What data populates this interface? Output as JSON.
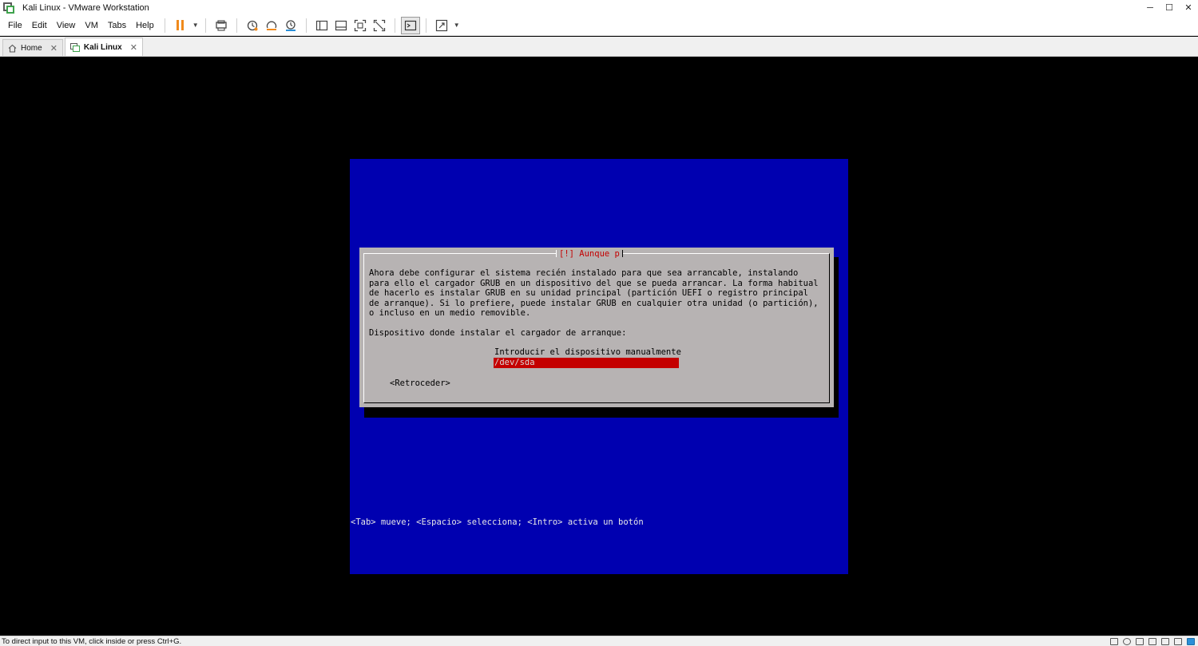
{
  "window": {
    "title": "Kali Linux - VMware Workstation",
    "controls": {
      "minimize": "─",
      "maximize": "☐",
      "close": "✕"
    }
  },
  "menu": [
    "File",
    "Edit",
    "View",
    "VM",
    "Tabs",
    "Help"
  ],
  "toolbar": {
    "icons": [
      "pause-icon",
      "send-ctrl-alt-del-icon",
      "snapshot-icon",
      "revert-snapshot-icon",
      "snapshot-manager-icon",
      "library-icon",
      "thumbnail-icon",
      "full-screen-icon",
      "unity-icon",
      "console-icon",
      "stretch-icon"
    ],
    "accent": "#f08a1c"
  },
  "tabs": [
    {
      "label": "Home",
      "active": false,
      "close": "✕"
    },
    {
      "label": "Kali Linux",
      "active": true,
      "close": "✕"
    }
  ],
  "installer": {
    "background": "#0000b0",
    "dialog": {
      "title": "[!] Aunque p",
      "body": "Ahora debe configurar el sistema recién instalado para que sea arrancable, instalando\npara ello el cargador GRUB en un dispositivo del que se pueda arrancar. La forma habitual\nde hacerlo es instalar GRUB en su unidad principal (partición UEFI o registro principal\nde arranque). Si lo prefiere, puede instalar GRUB en cualquier otra unidad (o partición),\no incluso en un medio removible.",
      "prompt": "Dispositivo donde instalar el cargador de arranque:",
      "options": [
        "Introducir el dispositivo manualmente",
        "/dev/sda"
      ],
      "selected_index": 1,
      "back_button": "<Retroceder>",
      "highlight_color": "#c40000"
    },
    "hint": "<Tab> mueve; <Espacio> selecciona; <Intro> activa un botón"
  },
  "statusbar": {
    "text": "To direct input to this VM, click inside or press Ctrl+G."
  }
}
